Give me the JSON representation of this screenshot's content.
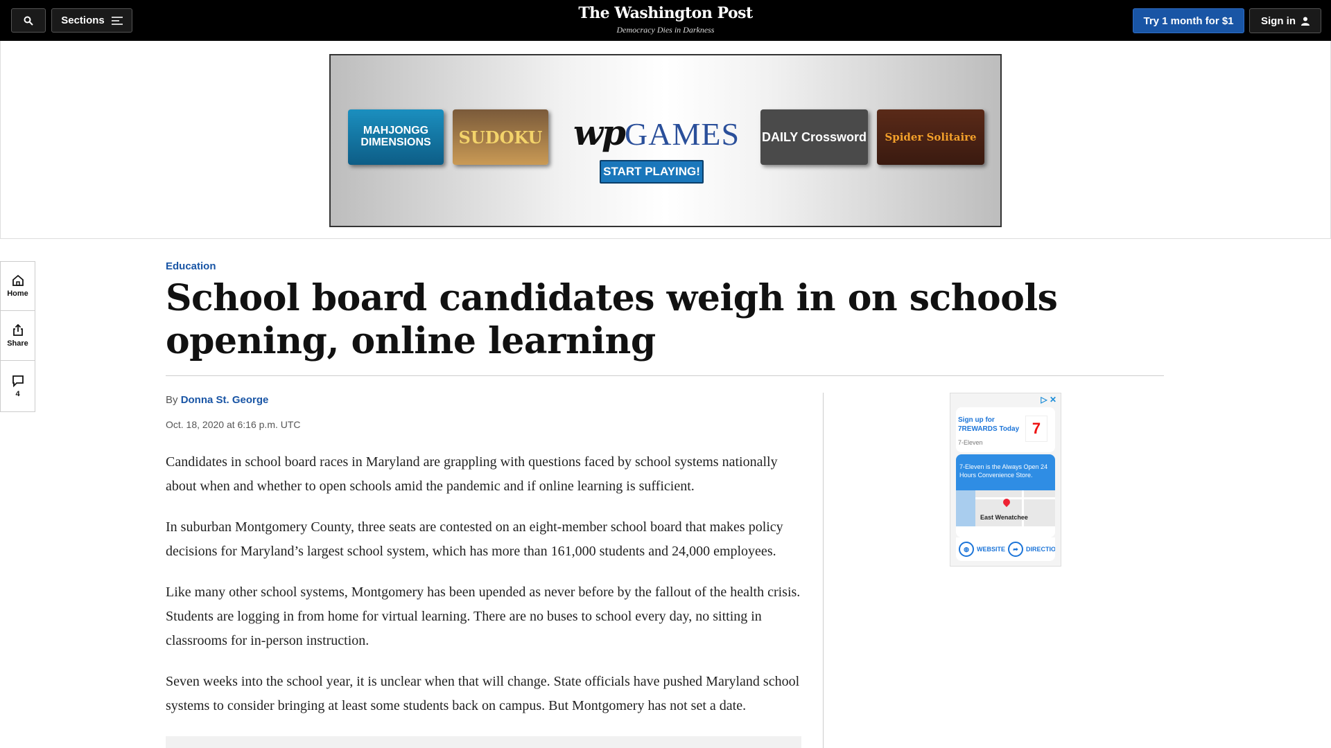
{
  "topbar": {
    "sections_label": "Sections",
    "logo": "The Washington Post",
    "tagline": "Democracy Dies in Darkness",
    "try_label": "Try 1 month for $1",
    "signin_label": "Sign in"
  },
  "ad": {
    "tiles": [
      "MAHJONGG DIMENSIONS",
      "SUDOKU",
      "DAILY Crossword",
      "Spider Solitaire"
    ],
    "brand_wp": "wp",
    "brand_games": "GAMES",
    "cta": "START PLAYING!"
  },
  "rail": {
    "home": "Home",
    "share": "Share",
    "comments": "4"
  },
  "article": {
    "kicker": "Education",
    "headline": "School board candidates weigh in on schools opening, online learning",
    "by": "By",
    "author": "Donna St. George",
    "date": "Oct. 18, 2020 at 6:16 p.m. UTC",
    "paragraphs": [
      "Candidates in school board races in Maryland are grappling with questions faced by school systems nationally about when and whether to open schools amid the pandemic and if online learning is sufficient.",
      "In suburban Montgomery County, three seats are contested on an eight-member school board that makes policy decisions for Maryland’s largest school system, which has more than 161,000 students and 24,000 employees.",
      "Like many other school systems, Montgomery has been upended as never before by the fallout of the health crisis. Students are logging in from home for virtual learning. There are no buses to school every day, no sitting in classrooms for in-person instruction.",
      "Seven weeks into the school year, it is unclear when that will change. State officials have pushed Maryland school systems to consider bringing at least some students back on campus. But Montgomery has not set a date."
    ]
  },
  "side_ad": {
    "signup": "Sign up for 7REWARDS Today",
    "brand": "7-Eleven",
    "logo_text": "7",
    "promo": "7-Eleven is the Always Open 24 Hours Convenience Store.",
    "map_label": "East Wenatchee",
    "website": "WEBSITE",
    "directions": "DIRECTIONS"
  },
  "colors": {
    "accent_blue": "#1955a5",
    "nav_black": "#000000"
  }
}
